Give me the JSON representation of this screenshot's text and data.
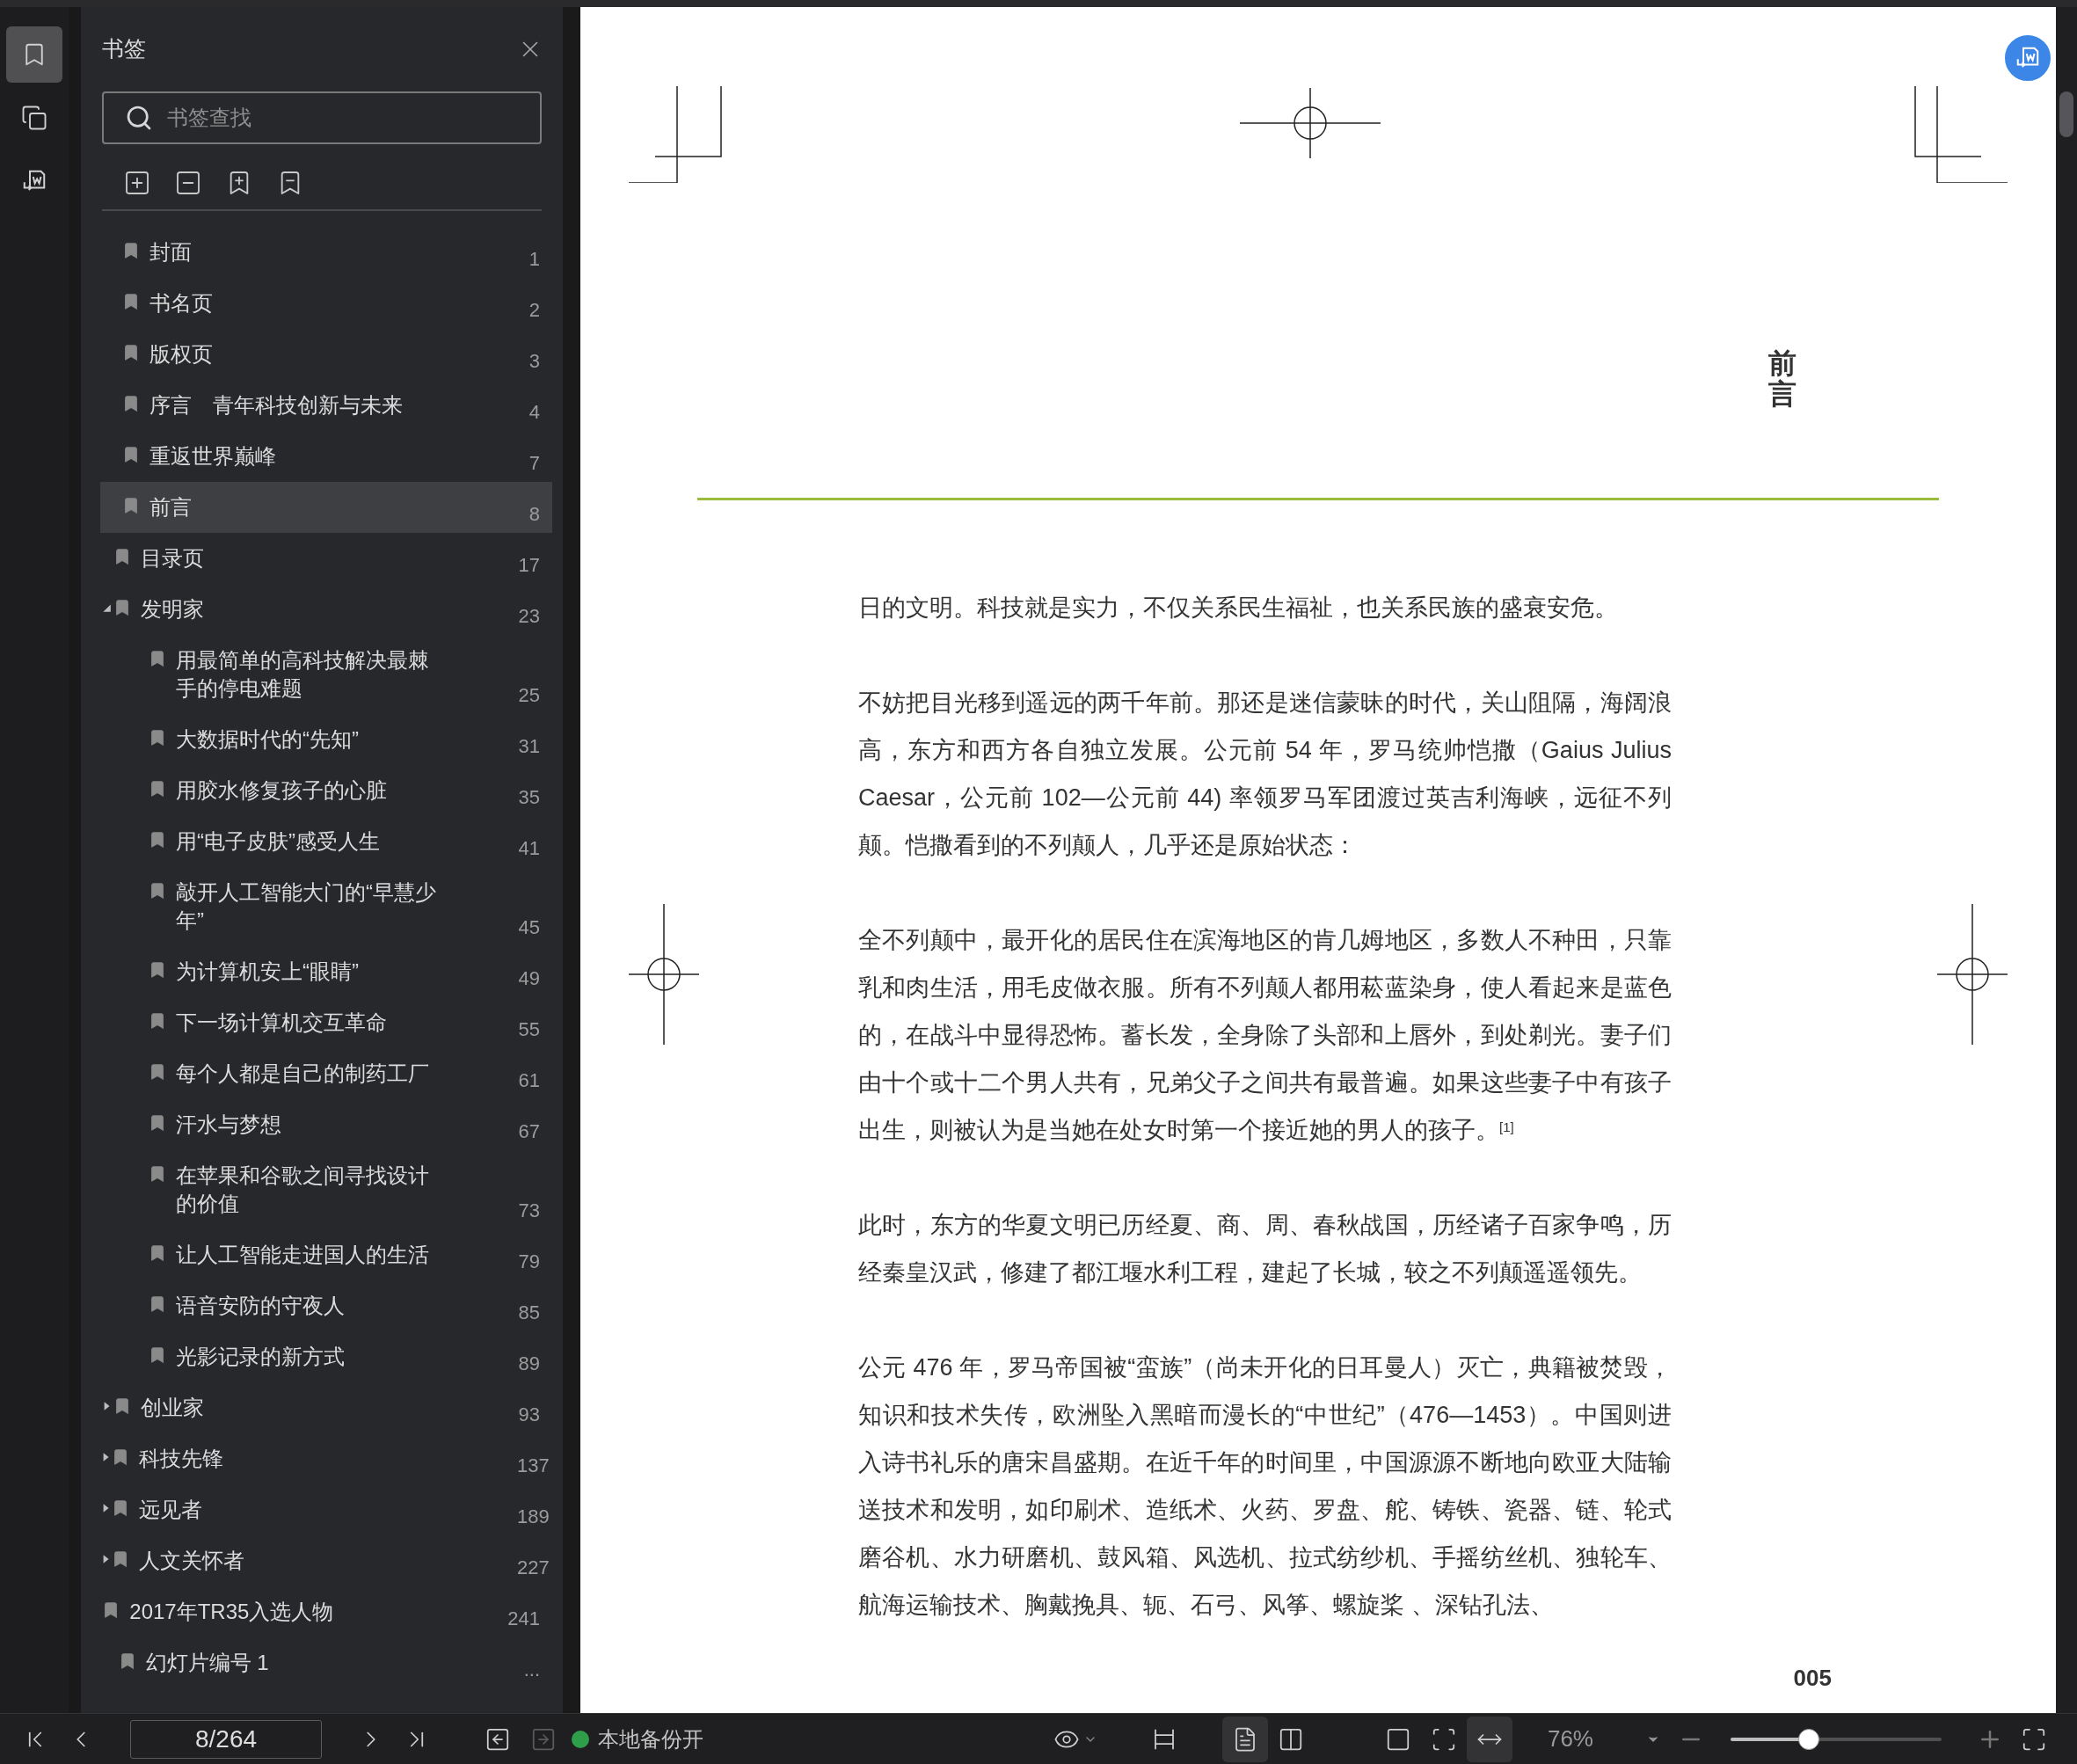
{
  "rail": [
    {
      "kind": "bookmarks",
      "selected": true
    },
    {
      "kind": "pages",
      "selected": false
    },
    {
      "kind": "convert",
      "selected": false
    }
  ],
  "sidebar": {
    "title": "书签",
    "search": {
      "placeholder": "书签查找"
    },
    "bookmarks": [
      {
        "label": "封面",
        "page": "1",
        "selected": false
      },
      {
        "label": "书名页",
        "page": "2",
        "selected": false
      },
      {
        "label": "版权页",
        "page": "3",
        "selected": false
      },
      {
        "label": "序言　青年科技创新与未来",
        "page": "4",
        "selected": false
      },
      {
        "label": "重返世界巅峰",
        "page": "7",
        "selected": false
      },
      {
        "label": "前言",
        "page": "8",
        "selected": true
      },
      {
        "label": "目录页",
        "page": "17",
        "selected": false
      },
      {
        "label": "发明家",
        "page": "23",
        "selected": false,
        "expanded": true,
        "children": [
          {
            "label": "用最简单的高科技解决最棘手的停电难题",
            "page": "25",
            "selected": false
          },
          {
            "label": "大数据时代的“先知”",
            "page": "31",
            "selected": false
          },
          {
            "label": "用胶水修复孩子的心脏",
            "page": "35",
            "selected": false
          },
          {
            "label": "用“电子皮肤”感受人生",
            "page": "41",
            "selected": false
          },
          {
            "label": "敲开人工智能大门的“早慧少年”",
            "page": "45",
            "selected": false
          },
          {
            "label": "为计算机安上“眼睛”",
            "page": "49",
            "selected": false
          },
          {
            "label": "下一场计算机交互革命",
            "page": "55",
            "selected": false
          },
          {
            "label": "每个人都是自己的制药工厂",
            "page": "61",
            "selected": false
          },
          {
            "label": "汗水与梦想",
            "page": "67",
            "selected": false
          },
          {
            "label": "在苹果和谷歌之间寻找设计的价值",
            "page": "73",
            "selected": false
          },
          {
            "label": "让人工智能走进国人的生活",
            "page": "79",
            "selected": false
          },
          {
            "label": "语音安防的守夜人",
            "page": "85",
            "selected": false
          },
          {
            "label": "光影记录的新方式",
            "page": "89",
            "selected": false
          }
        ]
      },
      {
        "label": "创业家",
        "page": "93",
        "selected": false,
        "expanded": false
      },
      {
        "label": "科技先锋",
        "page": "137",
        "selected": false,
        "expanded": false
      },
      {
        "label": "远见者",
        "page": "189",
        "selected": false,
        "expanded": false
      },
      {
        "label": "人文关怀者",
        "page": "227",
        "selected": false,
        "expanded": false
      },
      {
        "label": "2017年TR35入选人物",
        "page": "241",
        "selected": false
      },
      {
        "label": "幻灯片编号 1",
        "page": "...",
        "selected": false
      }
    ]
  },
  "document": {
    "heading": "前言",
    "page_number": "005",
    "paragraphs": [
      "日的文明。科技就是实力，不仅关系民生福祉，也关系民族的盛衰安危。",
      "不妨把目光移到遥远的两千年前。那还是迷信蒙昧的时代，关山阻隔，海阔浪高，东方和西方各自独立发展。公元前 54 年，罗马统帅恺撒（Gaius Julius Caesar，公元前 102—公元前 44) 率领罗马军团渡过英吉利海峡，远征不列颠。恺撒看到的不列颠人，几乎还是原始状态：",
      "全不列颠中，最开化的居民住在滨海地区的肯几姆地区，多数人不种田，只靠乳和肉生活，用毛皮做衣服。所有不列颠人都用菘蓝染身，使人看起来是蓝色的，在战斗中显得恐怖。蓄长发，全身除了头部和上唇外，到处剃光。妻子们由十个或十二个男人共有，兄弟父子之间共有最普遍。如果这些妻子中有孩子出生，则被认为是当她在处女时第一个接近她的男人的孩子。$^{[1]}$",
      "此时，东方的华夏文明已历经夏、商、周、春秋战国，历经诸子百家争鸣，历经秦皇汉武，修建了都江堰水利工程，建起了长城，较之不列颠遥遥领先。",
      "公元 476 年，罗马帝国被“蛮族”（尚未开化的日耳曼人）灭亡，典籍被焚毁，知识和技术失传，欧洲坠入黑暗而漫长的“中世纪”（476—1453）。中国则进入诗书礼乐的唐宋昌盛期。在近千年的时间里，中国源源不断地向欧亚大陆输送技术和发明，如印刷术、造纸术、火药、罗盘、舵、铸铁、瓷器、链、轮式磨谷机、水力研磨机、鼓风箱、风选机、拉式纺纱机、手摇纺丝机、独轮车、航海运输技术、胸戴挽具、轭、石弓、风筝、螺旋桨 、深钻孔法、"
    ]
  },
  "toolbar": {
    "page_field": "8/264",
    "back_disabled": false,
    "forward_disabled": true,
    "backup": {
      "label": "本地备份开",
      "on": true
    },
    "page_modes": [
      {
        "kind": "single",
        "selected": true
      },
      {
        "kind": "double",
        "selected": false
      }
    ],
    "fit_modes": [
      {
        "kind": "actual",
        "selected": false
      },
      {
        "kind": "page",
        "selected": false
      },
      {
        "kind": "width",
        "selected": true
      }
    ],
    "zoom": {
      "value": "76%",
      "level": 0.37
    }
  }
}
